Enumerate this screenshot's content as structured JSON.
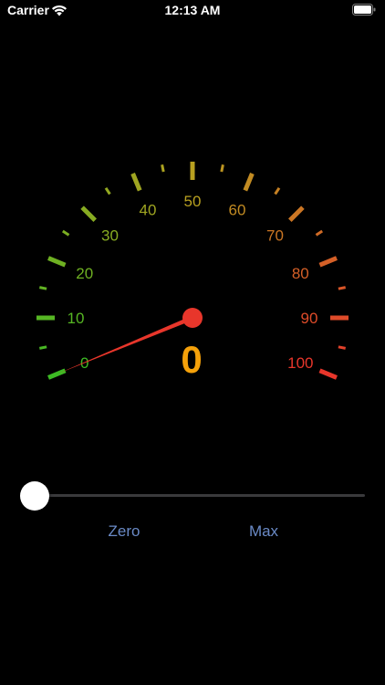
{
  "status_bar": {
    "carrier": "Carrier",
    "time": "12:13 AM"
  },
  "gauge": {
    "min": 0,
    "max": 100,
    "value": 0,
    "value_text": "0",
    "labels": [
      "0",
      "10",
      "20",
      "30",
      "40",
      "50",
      "60",
      "70",
      "80",
      "90",
      "100"
    ],
    "colors": {
      "low": "#3dbb24",
      "mid": "#b8a020",
      "high": "#e8362b",
      "value_text": "#f5a10a",
      "needle": "#e8362b"
    }
  },
  "slider": {
    "value": 0,
    "min": 0,
    "max": 100
  },
  "buttons": {
    "zero_label": "Zero",
    "max_label": "Max"
  }
}
